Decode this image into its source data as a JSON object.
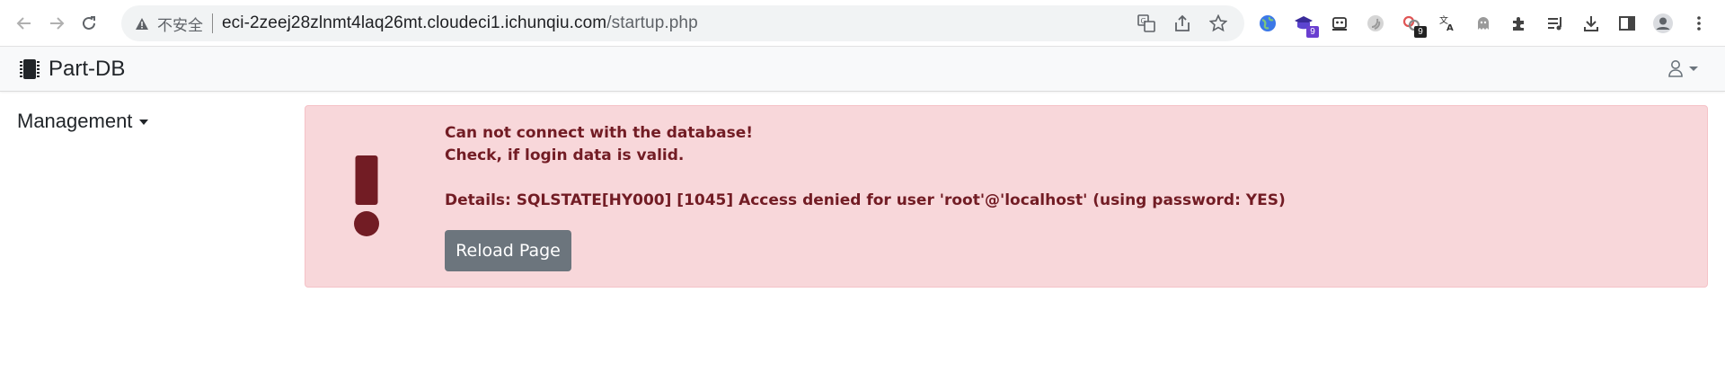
{
  "browser": {
    "security_label": "不安全",
    "url_host": "eci-2zeej28zlnmt4laq26mt.cloudeci1.ichunqiu.com",
    "url_path": "/startup.php",
    "extensions": [
      {
        "name": "globe-extension-icon"
      },
      {
        "name": "purple-extension-icon",
        "badge": "9",
        "badge_color": "#6a3fd0"
      },
      {
        "name": "bot-extension-icon"
      },
      {
        "name": "swirl-extension-icon"
      },
      {
        "name": "link-extension-icon",
        "badge": "9",
        "badge_color": "#222222"
      },
      {
        "name": "translate-icon"
      },
      {
        "name": "ghost-extension-icon"
      },
      {
        "name": "puzzle-icon"
      },
      {
        "name": "media-list-icon"
      },
      {
        "name": "download-icon"
      },
      {
        "name": "side-panel-icon"
      },
      {
        "name": "profile-avatar-icon"
      },
      {
        "name": "more-menu-icon"
      }
    ]
  },
  "navbar": {
    "brand": "Part-DB"
  },
  "sidebar": {
    "toggle_label": "Management"
  },
  "alert": {
    "line1": "Can not connect with the database!",
    "line2": "Check, if login data is valid.",
    "details": "Details: SQLSTATE[HY000] [1045] Access denied for user 'root'@'localhost' (using password: YES)",
    "reload_label": "Reload Page"
  },
  "colors": {
    "alert_bg": "#f8d7da",
    "alert_text": "#721c24",
    "button_bg": "#6c757d"
  }
}
